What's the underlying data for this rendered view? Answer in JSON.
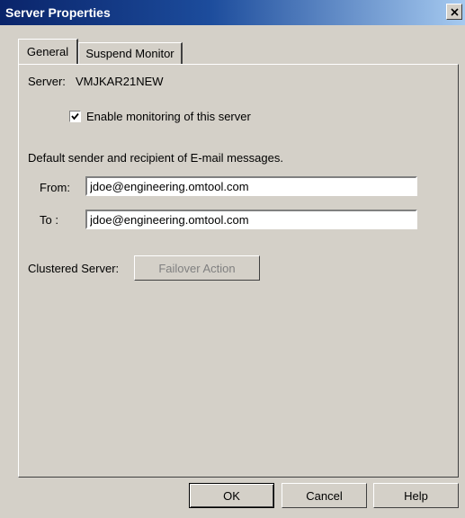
{
  "window": {
    "title": "Server Properties"
  },
  "tabs": [
    {
      "label": "General",
      "active": true
    },
    {
      "label": "Suspend Monitor",
      "active": false
    }
  ],
  "general": {
    "server_label": "Server:",
    "server_value": "VMJKAR21NEW",
    "enable_monitoring_label": "Enable monitoring of this server",
    "enable_monitoring_checked": true,
    "email_section_label": "Default sender and recipient of E-mail messages.",
    "from_label": "From:",
    "from_value": "jdoe@engineering.omtool.com",
    "to_label": "To :",
    "to_value": "jdoe@engineering.omtool.com",
    "clustered_label": "Clustered Server:",
    "failover_button": "Failover Action"
  },
  "buttons": {
    "ok": "OK",
    "cancel": "Cancel",
    "help": "Help"
  }
}
